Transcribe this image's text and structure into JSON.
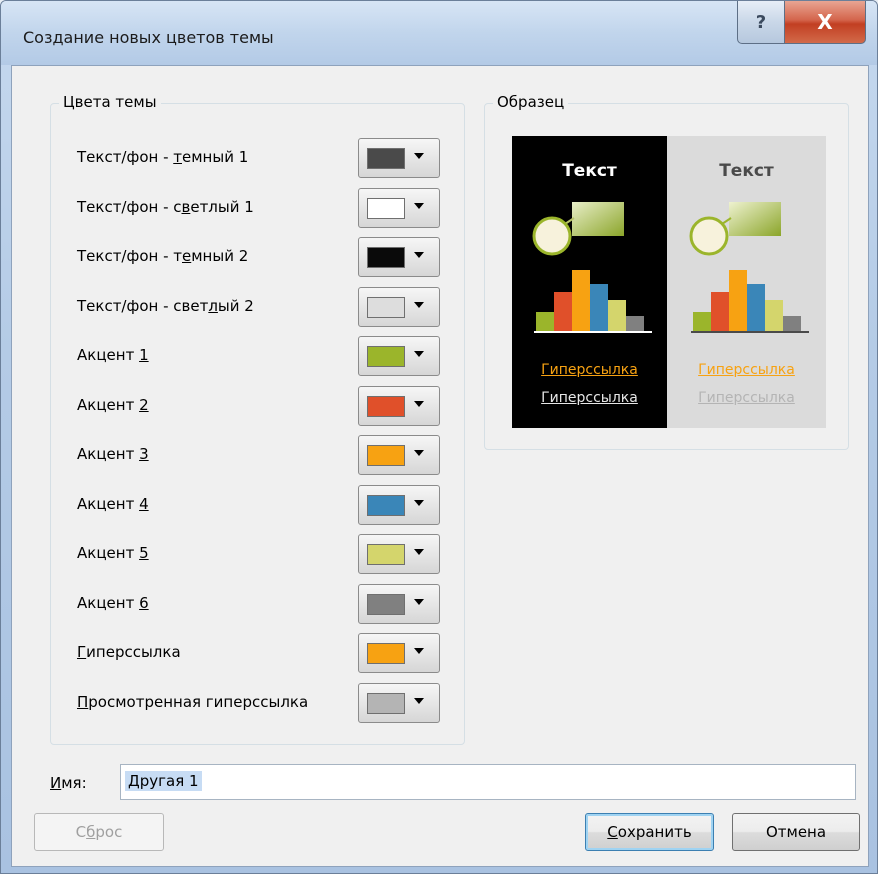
{
  "window": {
    "title": "Создание новых цветов темы",
    "help_label": "?",
    "close_label": "X"
  },
  "theme_colors": {
    "title": "Цвета темы",
    "items": [
      {
        "pre": "Текст/фон - ",
        "u": "т",
        "post": "емный 1",
        "color": "#4a4a4a"
      },
      {
        "pre": "Текст/фон - с",
        "u": "в",
        "post": "етлый 1",
        "color": "#ffffff"
      },
      {
        "pre": "Текст/фон - т",
        "u": "е",
        "post": "мный 2",
        "color": "#0a0a0a"
      },
      {
        "pre": "Текст/фон - свет",
        "u": "л",
        "post": "ый 2",
        "color": "#dddddd"
      },
      {
        "pre": "Акцент ",
        "u": "1",
        "post": "",
        "color": "#9bb52b"
      },
      {
        "pre": "Акцент ",
        "u": "2",
        "post": "",
        "color": "#e0502a"
      },
      {
        "pre": "Акцент ",
        "u": "3",
        "post": "",
        "color": "#f7a212"
      },
      {
        "pre": "Акцент ",
        "u": "4",
        "post": "",
        "color": "#3a86b8"
      },
      {
        "pre": "Акцент ",
        "u": "5",
        "post": "",
        "color": "#d4d56c"
      },
      {
        "pre": "Акцент ",
        "u": "6",
        "post": "",
        "color": "#808080"
      },
      {
        "pre": "",
        "u": "Г",
        "post": "иперссылка",
        "color": "#f7a212"
      },
      {
        "pre": "",
        "u": "П",
        "post": "росмотренная гиперссылка",
        "color": "#b4b4b4"
      }
    ]
  },
  "sample": {
    "title": "Образец",
    "text_label": "Текст",
    "hyperlink_label": "Гиперссылка",
    "visited_label": "Гиперссылка",
    "dark_bg": "#000000",
    "light_bg": "#dbdbdb",
    "dark_text": "#ffffff",
    "light_text": "#4a4a4a",
    "link_color": "#f7a212",
    "visited_dark": "#e6e6e6",
    "visited_light": "#b4b4b4"
  },
  "name_field": {
    "label_u": "И",
    "label_rest": "мя:",
    "value": "Другая 1"
  },
  "buttons": {
    "reset_pre": "С",
    "reset_u": "б",
    "reset_post": "рос",
    "save_u": "С",
    "save_post": "охранить",
    "cancel": "Отмена"
  }
}
